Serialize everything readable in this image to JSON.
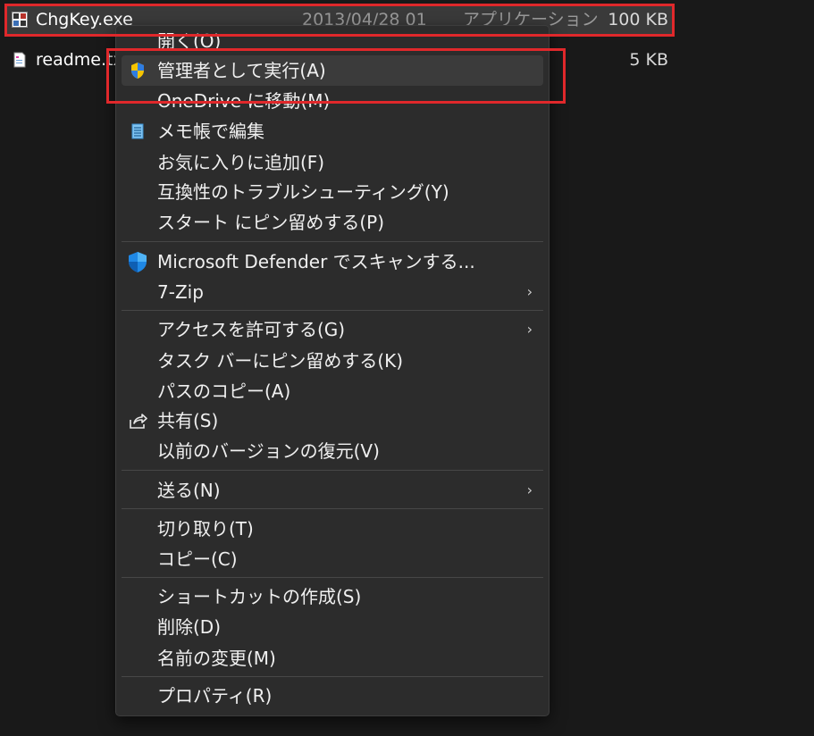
{
  "files": [
    {
      "name": "ChgKey.exe",
      "date": "2013/04/28 01",
      "type": "アプリケーション",
      "size": "100 KB",
      "icon": "application-exe-icon"
    },
    {
      "name": "readme.txt",
      "size": "5 KB",
      "icon": "text-file-icon"
    }
  ],
  "menu": {
    "items": [
      {
        "label": "開く(O)"
      },
      {
        "label": "管理者として実行(A)",
        "icon": "uac-shield-icon"
      },
      {
        "label": "OneDrive に移動(M)"
      },
      {
        "label": "メモ帳で編集",
        "icon": "notepad-icon"
      },
      {
        "label": "お気に入りに追加(F)"
      },
      {
        "label": "互換性のトラブルシューティング(Y)"
      },
      {
        "label": "スタート にピン留めする(P)"
      },
      {
        "label": "Microsoft Defender でスキャンする...",
        "icon": "defender-shield-icon"
      },
      {
        "label": "7-Zip",
        "submenu": true
      },
      {
        "label": "アクセスを許可する(G)",
        "submenu": true
      },
      {
        "label": "タスク バーにピン留めする(K)"
      },
      {
        "label": "パスのコピー(A)"
      },
      {
        "label": "共有(S)",
        "icon": "share-icon"
      },
      {
        "label": "以前のバージョンの復元(V)"
      },
      {
        "label": "送る(N)",
        "submenu": true
      },
      {
        "label": "切り取り(T)"
      },
      {
        "label": "コピー(C)"
      },
      {
        "label": "ショートカットの作成(S)"
      },
      {
        "label": "削除(D)"
      },
      {
        "label": "名前の変更(M)"
      },
      {
        "label": "プロパティ(R)"
      }
    ],
    "chevron": "›"
  },
  "colors": {
    "highlight_box": "#e0282b",
    "menu_bg": "#2c2c2c",
    "page_bg": "#191919"
  }
}
